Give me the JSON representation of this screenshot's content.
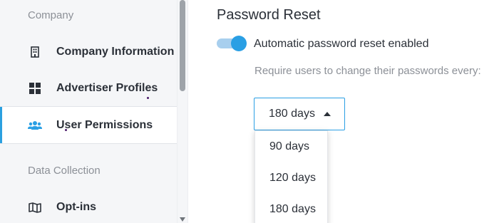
{
  "sidebar": {
    "sections": [
      {
        "label": "Company"
      },
      {
        "label": "Data Collection"
      }
    ],
    "items": [
      {
        "label": "Company Information",
        "icon": "building-icon"
      },
      {
        "label": "Advertiser Profiles",
        "icon": "grid-icon"
      },
      {
        "label": "User Permissions",
        "icon": "users-icon",
        "active": true
      },
      {
        "label": "Opt-ins",
        "icon": "map-icon"
      }
    ]
  },
  "main": {
    "title": "Password Reset",
    "toggle": {
      "label": "Automatic password reset enabled",
      "on": true
    },
    "hint": "Require users to change their passwords every:",
    "select": {
      "value": "180 days",
      "options": [
        "90 days",
        "120 days",
        "180 days"
      ]
    }
  },
  "colors": {
    "accent": "#2a9fe4",
    "sidebar_bg": "#f5f6f8",
    "text": "#2b3038",
    "muted": "#8c9097"
  }
}
